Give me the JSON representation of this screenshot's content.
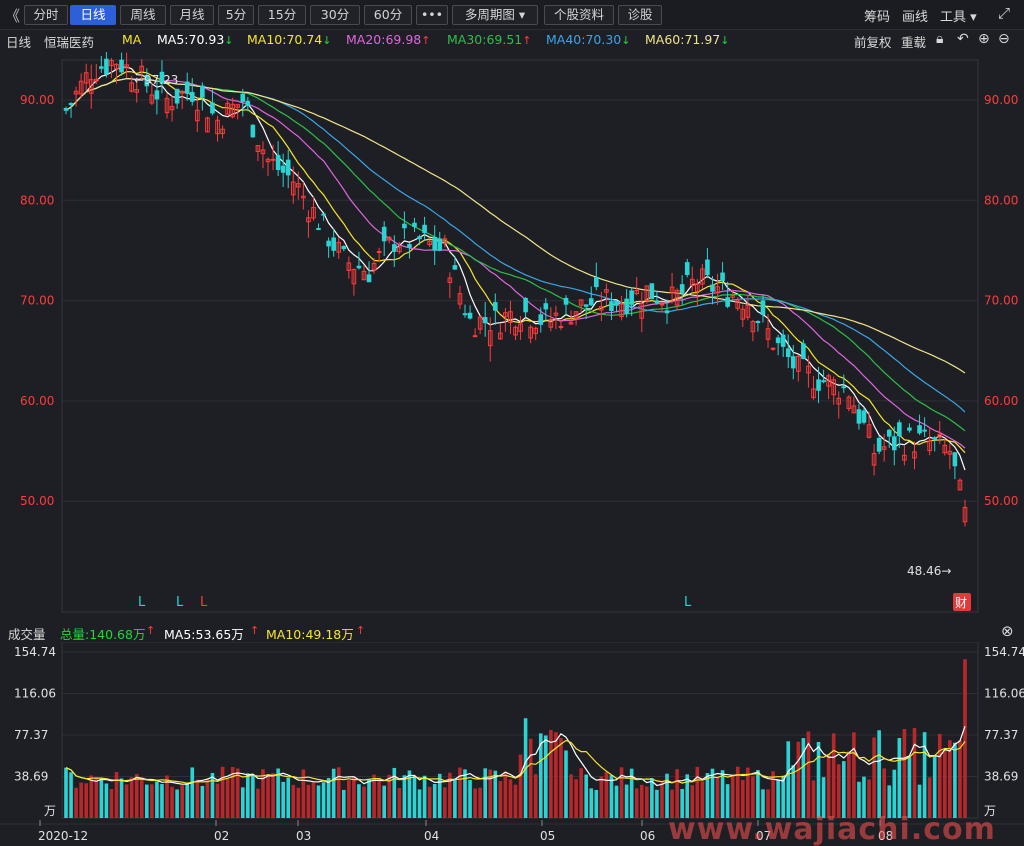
{
  "toolbar": {
    "back_glyph": "《",
    "buttons": [
      {
        "label": "分时",
        "active": false
      },
      {
        "label": "日线",
        "active": true
      },
      {
        "label": "周线",
        "active": false
      },
      {
        "label": "月线",
        "active": false
      },
      {
        "label": "5分",
        "active": false
      },
      {
        "label": "15分",
        "active": false
      },
      {
        "label": "30分",
        "active": false
      },
      {
        "label": "60分",
        "active": false
      },
      {
        "label": "•••",
        "active": false
      },
      {
        "label": "多周期图 ▾",
        "active": false
      },
      {
        "label": "个股资料",
        "active": false
      },
      {
        "label": "诊股",
        "active": false
      }
    ],
    "right": {
      "chips": "筹码",
      "draw": "画线",
      "tools": "工具 ▾",
      "fullscreen_icon": "expand-icon"
    }
  },
  "ma_header": {
    "period": "日线",
    "stock_name": "恒瑞医药",
    "ma_label": "MA",
    "items": [
      {
        "label": "MA5:70.93",
        "dir": "down",
        "color": "#ffffff"
      },
      {
        "label": "MA10:70.74",
        "dir": "down",
        "color": "#f5e62a"
      },
      {
        "label": "MA20:69.98",
        "dir": "up",
        "color": "#e066e0"
      },
      {
        "label": "MA30:69.51",
        "dir": "up",
        "color": "#2cbf4a"
      },
      {
        "label": "MA40:70.30",
        "dir": "down",
        "color": "#3aa6e8"
      },
      {
        "label": "MA60:71.97",
        "dir": "down",
        "color": "#efe48a"
      }
    ],
    "adjust": "前复权",
    "overlay": "重载"
  },
  "price_axis": {
    "ticks": [
      "90.00",
      "80.00",
      "70.00",
      "60.00",
      "50.00"
    ]
  },
  "price_annotations": {
    "high": "←97.23",
    "low": "48.46→",
    "cai": "财"
  },
  "signal_marks": [
    "L",
    "L",
    "L",
    "L"
  ],
  "volume_header": {
    "title": "成交量",
    "total": "总量:140.68万",
    "ma5": "MA5:53.65万",
    "ma10": "MA10:49.18万"
  },
  "volume_axis": {
    "ticks": [
      "154.74",
      "116.06",
      "77.37",
      "38.69"
    ],
    "unit": "万"
  },
  "date_axis": [
    "2020-12",
    "02",
    "03",
    "04",
    "05",
    "06",
    "07",
    "08"
  ],
  "watermark": "www.wajiachi.com",
  "colors": {
    "up": "#ff3b3b",
    "down": "#2ad4d4",
    "grid": "#2e2f36"
  }
}
